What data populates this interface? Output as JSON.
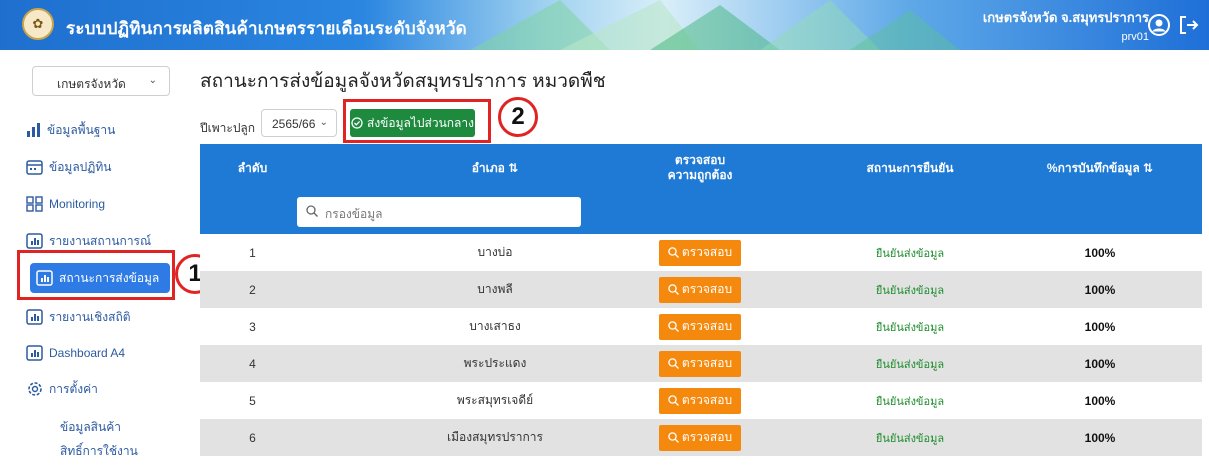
{
  "header": {
    "app_title": "ระบบปฏิทินการผลิตสินค้าเกษตรรายเดือนระดับจังหวัด",
    "user_org": "เกษตรจังหวัด จ.สมุทรปราการ",
    "user_id": "prv01"
  },
  "sidebar": {
    "role_select": "เกษตรจังหวัด",
    "items": [
      {
        "label": "ข้อมูลพื้นฐาน"
      },
      {
        "label": "ข้อมูลปฏิทิน"
      },
      {
        "label": "Monitoring"
      },
      {
        "label": "รายงานสถานการณ์"
      },
      {
        "label": "สถานะการส่งข้อมูล"
      },
      {
        "label": "รายงานเชิงสถิติ"
      },
      {
        "label": "Dashboard A4"
      },
      {
        "label": "การตั้งค่า"
      }
    ],
    "sub_items": [
      {
        "label": "ข้อมูลสินค้า"
      },
      {
        "label": "สิทธิ์การใช้งาน"
      }
    ]
  },
  "main": {
    "title": "สถานะการส่งข้อมูลจังหวัดสมุทรปราการ หมวดพืช",
    "season_label": "ปีเพาะปลูก",
    "season_value": "2565/66",
    "send_button": "ส่งข้อมูลไปส่วนกลาง",
    "search_placeholder": "กรองข้อมูล",
    "columns": [
      "ลำดับ",
      "อำเภอ ⇅",
      "ตรวจสอบ",
      "ความถูกต้อง",
      "สถานะการยืนยัน",
      "%การบันทึกข้อมูล ⇅"
    ],
    "check_label": "ตรวจสอบ",
    "rows": [
      {
        "no": "1",
        "district": "บางบ่อ",
        "status": "ยืนยันส่งข้อมูล",
        "pct": "100%"
      },
      {
        "no": "2",
        "district": "บางพลี",
        "status": "ยืนยันส่งข้อมูล",
        "pct": "100%"
      },
      {
        "no": "3",
        "district": "บางเสาธง",
        "status": "ยืนยันส่งข้อมูล",
        "pct": "100%"
      },
      {
        "no": "4",
        "district": "พระประแดง",
        "status": "ยืนยันส่งข้อมูล",
        "pct": "100%"
      },
      {
        "no": "5",
        "district": "พระสมุทรเจดีย์",
        "status": "ยืนยันส่งข้อมูล",
        "pct": "100%"
      },
      {
        "no": "6",
        "district": "เมืองสมุทรปราการ",
        "status": "ยืนยันส่งข้อมูล",
        "pct": "100%"
      }
    ]
  },
  "callouts": [
    "1",
    "2"
  ],
  "colors": {
    "primary": "#1f7ad6",
    "send": "#1d8a3e",
    "check": "#f5890d",
    "ok": "#1c8c2c",
    "callout": "#e02424"
  }
}
